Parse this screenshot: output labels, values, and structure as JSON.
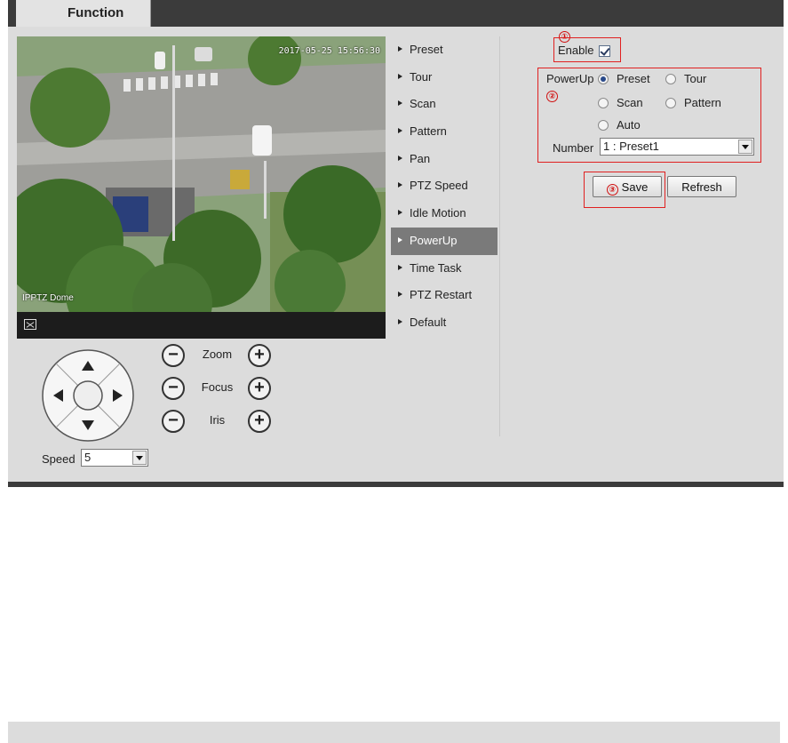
{
  "tab": {
    "title": "Function"
  },
  "video": {
    "timestamp": "2017-05-25 15:56:30",
    "channel_label": "IPPTZ Dome"
  },
  "ptz": {
    "speed_label": "Speed",
    "speed_value": "5",
    "controls": [
      {
        "label": "Zoom"
      },
      {
        "label": "Focus"
      },
      {
        "label": "Iris"
      }
    ],
    "minus_glyph": "−",
    "plus_glyph": "+"
  },
  "menu": {
    "items": [
      {
        "label": "Preset"
      },
      {
        "label": "Tour"
      },
      {
        "label": "Scan"
      },
      {
        "label": "Pattern"
      },
      {
        "label": "Pan"
      },
      {
        "label": "PTZ Speed"
      },
      {
        "label": "Idle Motion"
      },
      {
        "label": "PowerUp"
      },
      {
        "label": "Time Task"
      },
      {
        "label": "PTZ Restart"
      },
      {
        "label": "Default"
      }
    ],
    "active": "PowerUp"
  },
  "panel": {
    "enable_label": "Enable",
    "enable_checked": true,
    "powerup_label": "PowerUp",
    "options": [
      {
        "label": "Preset",
        "selected": true
      },
      {
        "label": "Tour",
        "selected": false
      },
      {
        "label": "Scan",
        "selected": false
      },
      {
        "label": "Pattern",
        "selected": false
      },
      {
        "label": "Auto",
        "selected": false
      }
    ],
    "number_label": "Number",
    "number_value": "1 : Preset1",
    "save_label": "Save",
    "refresh_label": "Refresh"
  },
  "annotations": [
    "①",
    "②",
    "③"
  ],
  "colors": {
    "annotation": "#e02020",
    "active_menu": "#7a7a7a",
    "chrome": "#3b3b3b"
  }
}
